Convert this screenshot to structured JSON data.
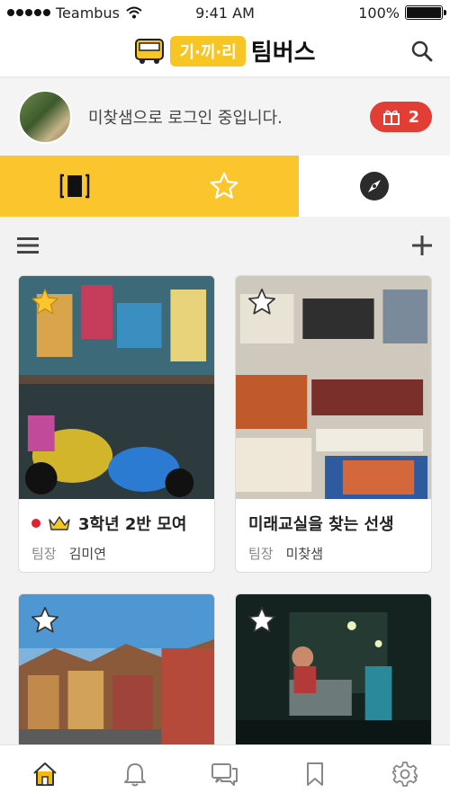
{
  "status_bar": {
    "carrier": "Teambus",
    "time": "9:41 AM",
    "battery": "100%",
    "battery_level": 1.0
  },
  "header": {
    "logo_badge": "기·끼·리",
    "logo_text": "팀버스",
    "search_icon": "search-icon"
  },
  "login": {
    "message": "미찾샘으로 로그인 중입니다.",
    "gift_count": "2",
    "gift_icon": "gift-icon"
  },
  "tabs": [
    {
      "icon": "board-icon",
      "active": false
    },
    {
      "icon": "star-icon",
      "active": true
    },
    {
      "icon": "compass-icon",
      "active": false
    }
  ],
  "toolbar": {
    "menu_icon": "hamburger-icon",
    "add_icon": "plus-icon"
  },
  "cards": [
    {
      "title": "3학년 2반 모여",
      "leader_label": "팀장",
      "leader_name": "김미연",
      "starred": true,
      "has_dot": true,
      "has_crown": true
    },
    {
      "title": "미래교실을 찾는 선생",
      "leader_label": "팀장",
      "leader_name": "미찾샘",
      "starred": false,
      "has_dot": false,
      "has_crown": false
    },
    {
      "title": "",
      "leader_label": "",
      "leader_name": "",
      "starred": false
    },
    {
      "title": "",
      "leader_label": "",
      "leader_name": "",
      "starred": false
    }
  ],
  "bottom_nav": [
    "home-icon",
    "bell-icon",
    "chat-icon",
    "bookmark-icon",
    "settings-icon"
  ],
  "colors": {
    "accent": "#fbc52d",
    "badge": "#e33e36",
    "home_active": "#f2b90f"
  }
}
